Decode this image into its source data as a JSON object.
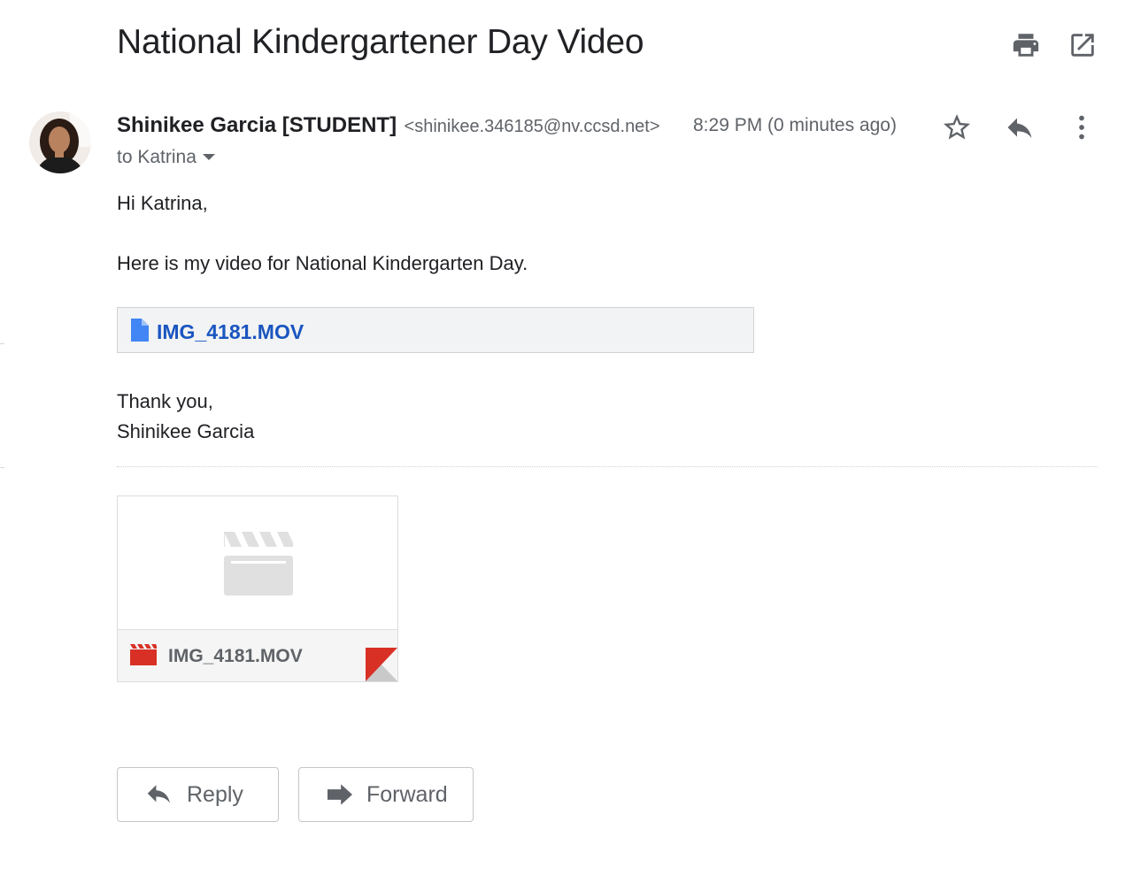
{
  "email": {
    "subject": "National Kindergartener Day Video",
    "sender_name": "Shinikee Garcia [STUDENT]",
    "sender_email": "<shinikee.346185@nv.ccsd.net>",
    "time": "8:29 PM (0 minutes ago)",
    "to_label": "to Katrina",
    "greeting": "Hi Katrina,",
    "body": "Here is my video for National Kindergarten Day.",
    "closing": "Thank you,",
    "signature": "Shinikee Garcia"
  },
  "attachment": {
    "inline_name": "IMG_4181.MOV",
    "card_name": "IMG_4181.MOV"
  },
  "actions": {
    "reply_label": "Reply",
    "forward_label": "Forward"
  },
  "icons": {
    "print": "print-icon",
    "open_new_window": "open-in-new-window-icon",
    "star": "star-icon",
    "reply": "reply-icon",
    "more": "more-vert-icon",
    "dropdown": "caret-down-icon",
    "file": "file-icon",
    "video": "video-clapper-icon"
  },
  "colors": {
    "attachment_link": "#1a55c0",
    "file_icon": "#4285f4",
    "video_icon": "#d93025",
    "text": "#202124",
    "muted": "#5f6368"
  }
}
